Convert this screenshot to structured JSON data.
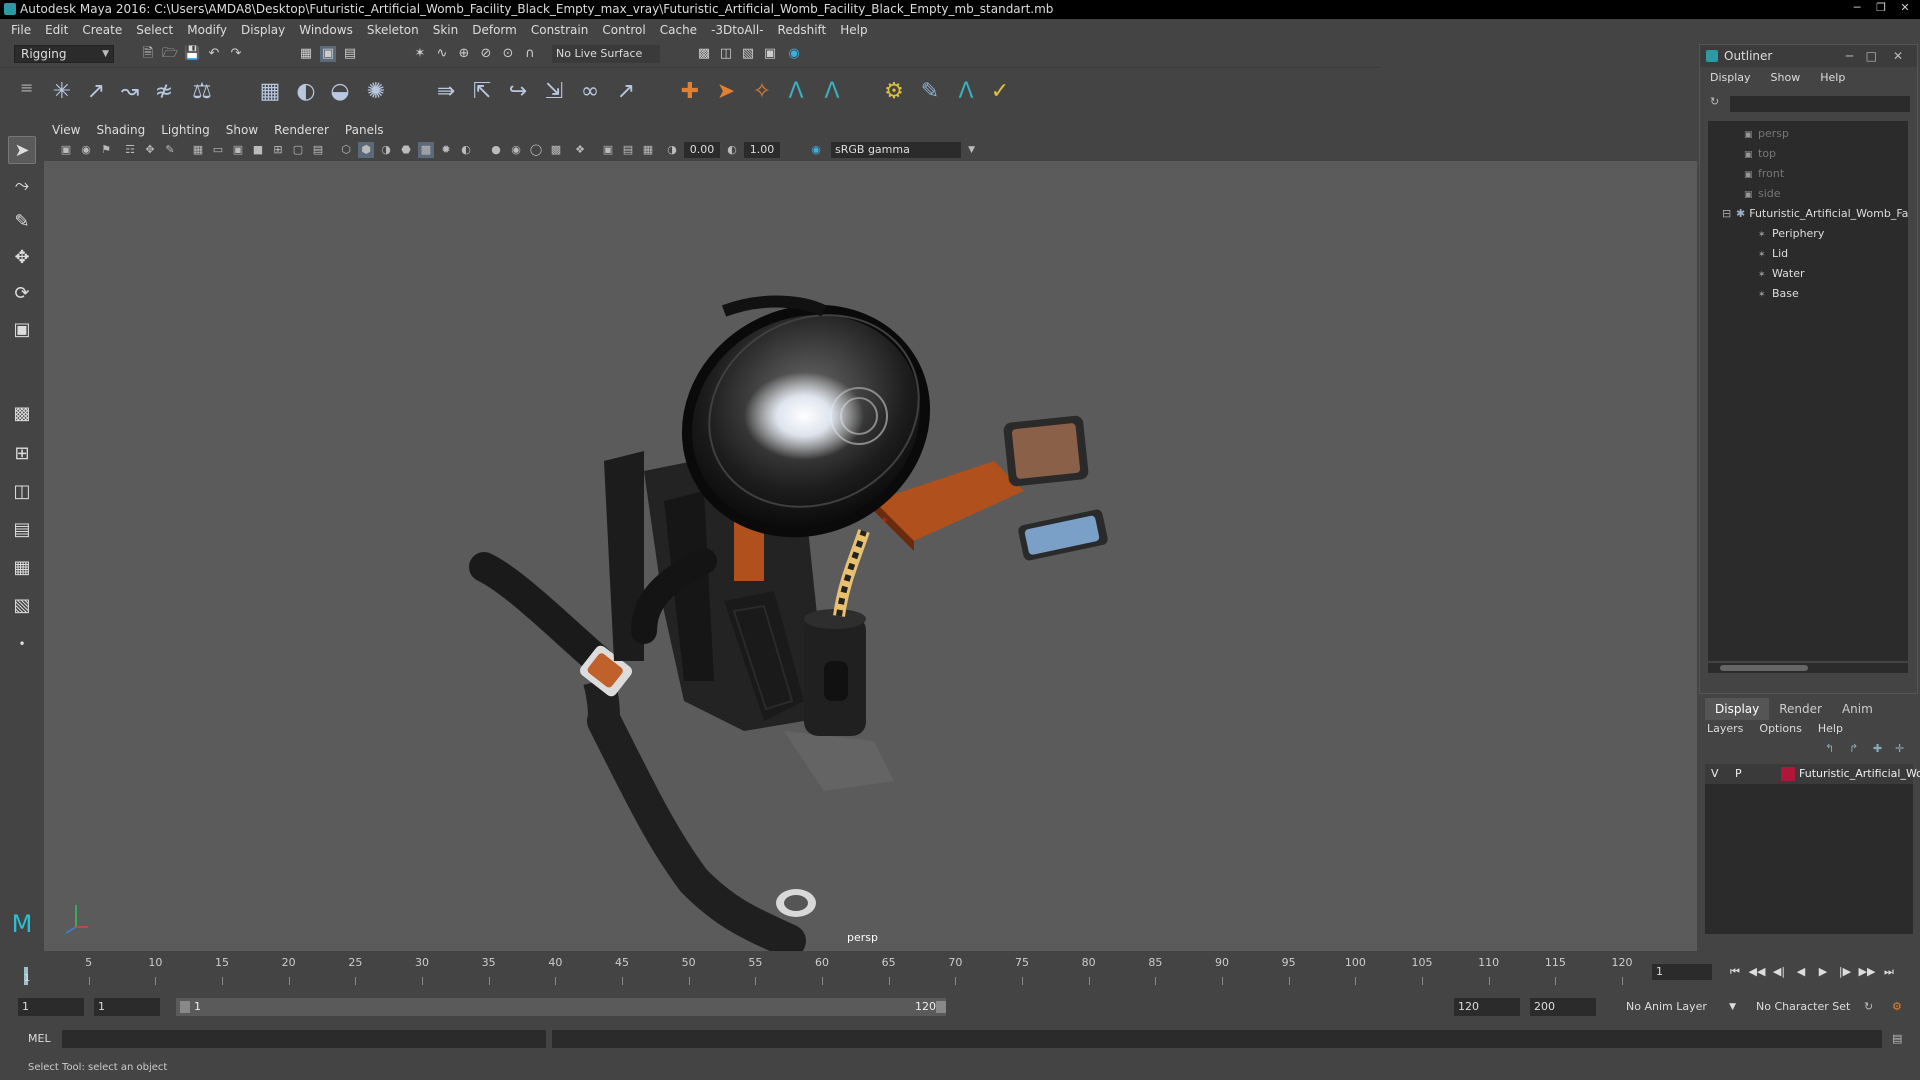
{
  "window": {
    "title": "Autodesk Maya 2016: C:\\Users\\AMDA8\\Desktop\\Futuristic_Artificial_Womb_Facility_Black_Empty_max_vray\\Futuristic_Artificial_Womb_Facility_Black_Empty_mb_standart.mb",
    "buttons": [
      "minimize-icon",
      "restore-icon",
      "close-icon"
    ]
  },
  "menubar": [
    "File",
    "Edit",
    "Create",
    "Select",
    "Modify",
    "Display",
    "Windows",
    "Skeleton",
    "Skin",
    "Deform",
    "Constrain",
    "Control",
    "Cache",
    "-3DtoAll-",
    "Redshift",
    "Help"
  ],
  "statusline": {
    "mode": "Rigging",
    "live_surface": "No Live Surface"
  },
  "panel": {
    "menu": [
      "View",
      "Shading",
      "Lighting",
      "Show",
      "Renderer",
      "Panels"
    ],
    "exposure": "0.00",
    "gamma": "1.00",
    "colorspace": "sRGB gamma",
    "camera": "persp"
  },
  "outliner": {
    "title": "Outliner",
    "menu": [
      "Display",
      "Show",
      "Help"
    ],
    "items": [
      {
        "label": "persp",
        "type": "camera"
      },
      {
        "label": "top",
        "type": "camera"
      },
      {
        "label": "front",
        "type": "camera"
      },
      {
        "label": "side",
        "type": "camera"
      },
      {
        "label": "Futuristic_Artificial_Womb_Facility_Black_Empty",
        "type": "group"
      },
      {
        "label": "Periphery",
        "type": "mesh"
      },
      {
        "label": "Lid",
        "type": "mesh"
      },
      {
        "label": "Water",
        "type": "mesh"
      },
      {
        "label": "Base",
        "type": "mesh"
      }
    ]
  },
  "layer_editor": {
    "tabs": [
      "Display",
      "Render",
      "Anim"
    ],
    "active_tab": "Display",
    "menu": [
      "Layers",
      "Options",
      "Help"
    ],
    "layer": {
      "v": "V",
      "p": "P",
      "name": "Futuristic_Artificial_Womb",
      "color": "#b0163a"
    }
  },
  "timeline": {
    "ticks": [
      "5",
      "10",
      "15",
      "20",
      "25",
      "30",
      "35",
      "40",
      "45",
      "50",
      "55",
      "60",
      "65",
      "70",
      "75",
      "80",
      "85",
      "90",
      "95",
      "100",
      "105",
      "110",
      "115",
      "120"
    ],
    "current_marker": "1",
    "current_frame": "1"
  },
  "range": {
    "start": "1",
    "playback_start": "1",
    "bar_start": "1",
    "bar_end": "120",
    "playback_end": "120",
    "end": "200",
    "anim_layer": "No Anim Layer",
    "character_set": "No Character Set"
  },
  "cmdline": {
    "label": "MEL"
  },
  "helpline": "Select Tool: select an object",
  "colors": {
    "viewport_bg": "#5b5b5b",
    "ui_bg": "#444444",
    "field_bg": "#2b2b2b",
    "accent": "#2a9aa5"
  }
}
